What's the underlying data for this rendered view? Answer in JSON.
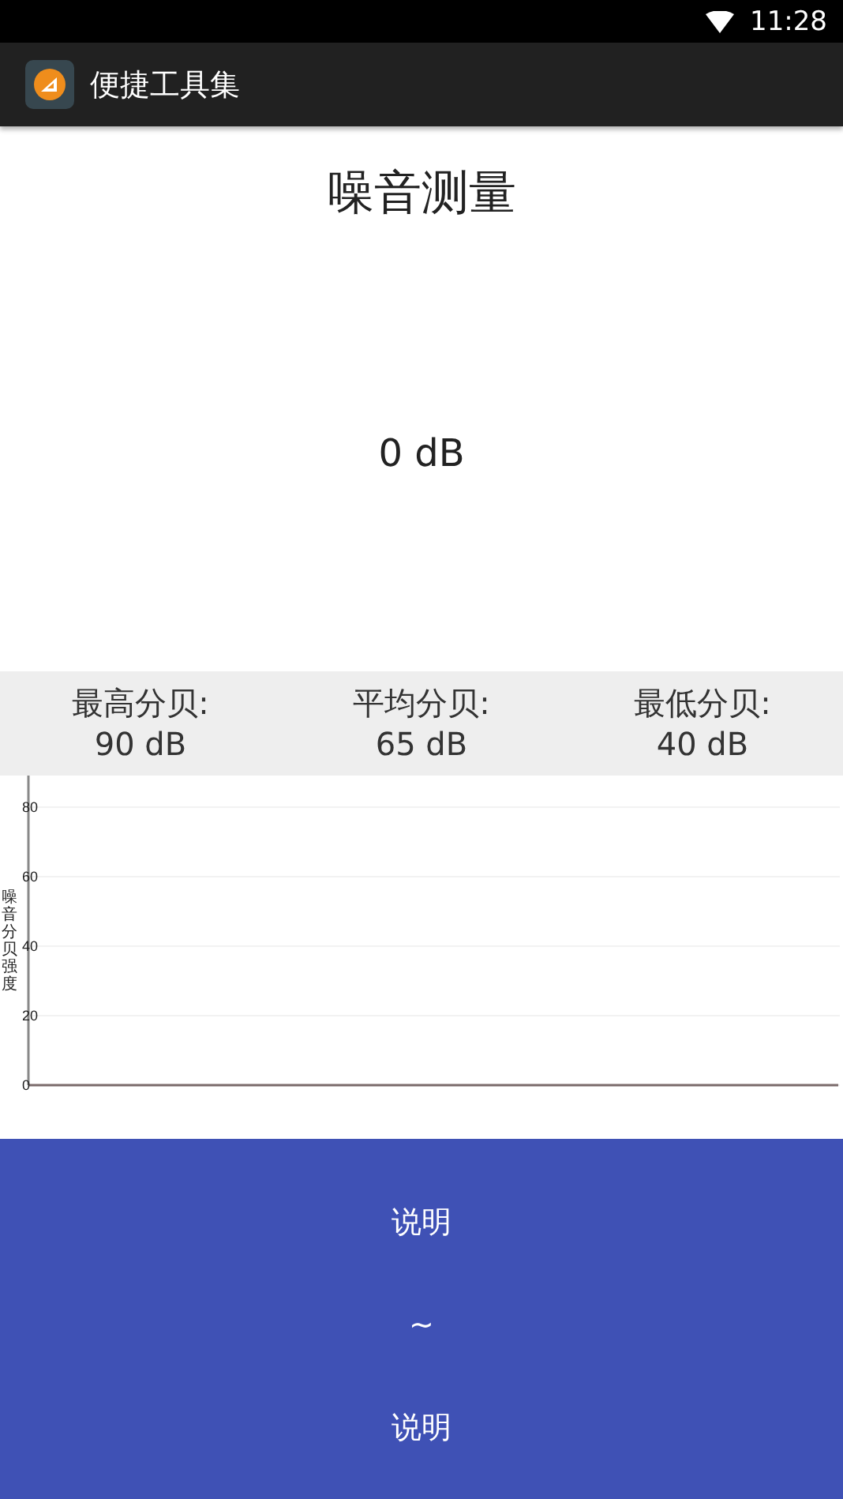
{
  "status_bar": {
    "time": "11:28"
  },
  "app_bar": {
    "title": "便捷工具集"
  },
  "meter": {
    "title": "噪音测量",
    "reading": "0 dB"
  },
  "stats": [
    {
      "label": "最高分贝:",
      "value": "90 dB"
    },
    {
      "label": "平均分贝:",
      "value": "65 dB"
    },
    {
      "label": "最低分贝:",
      "value": "40 dB"
    }
  ],
  "chart": {
    "y_axis_title": "噪音分贝强度",
    "y_tick_labels": [
      "80",
      "60",
      "40",
      "20",
      "0"
    ]
  },
  "info_panel": {
    "lines": [
      "说明",
      "~",
      "说明"
    ]
  }
}
